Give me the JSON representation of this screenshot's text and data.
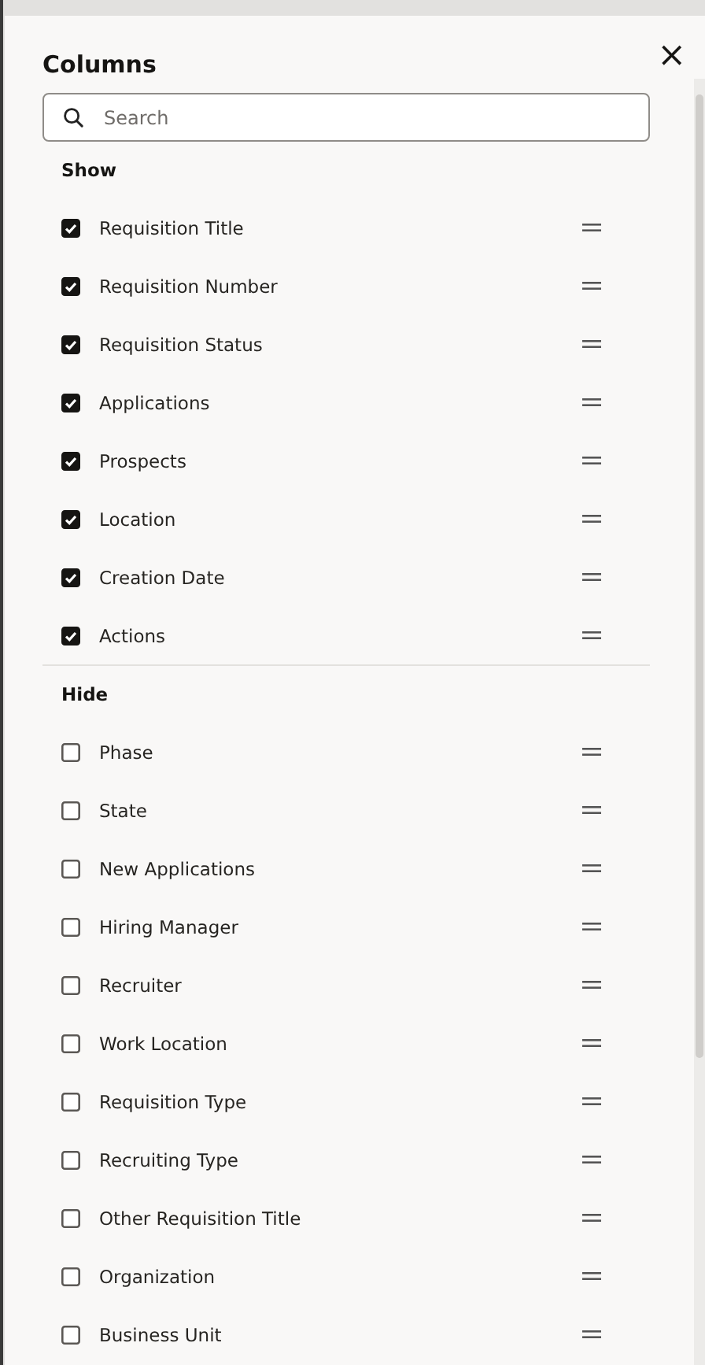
{
  "panel": {
    "title": "Columns",
    "close": "×"
  },
  "search": {
    "placeholder": "Search"
  },
  "sections": [
    {
      "heading": "Show",
      "items": [
        {
          "label": "Requisition Title",
          "checked": true
        },
        {
          "label": "Requisition Number",
          "checked": true
        },
        {
          "label": "Requisition Status",
          "checked": true
        },
        {
          "label": "Applications",
          "checked": true
        },
        {
          "label": "Prospects",
          "checked": true
        },
        {
          "label": "Location",
          "checked": true
        },
        {
          "label": "Creation Date",
          "checked": true
        },
        {
          "label": "Actions",
          "checked": true
        }
      ]
    },
    {
      "heading": "Hide",
      "items": [
        {
          "label": "Phase",
          "checked": false
        },
        {
          "label": "State",
          "checked": false
        },
        {
          "label": "New Applications",
          "checked": false
        },
        {
          "label": "Hiring Manager",
          "checked": false
        },
        {
          "label": "Recruiter",
          "checked": false
        },
        {
          "label": "Work Location",
          "checked": false
        },
        {
          "label": "Requisition Type",
          "checked": false
        },
        {
          "label": "Recruiting Type",
          "checked": false
        },
        {
          "label": "Other Requisition Title",
          "checked": false
        },
        {
          "label": "Organization",
          "checked": false
        },
        {
          "label": "Business Unit",
          "checked": false
        }
      ]
    }
  ]
}
